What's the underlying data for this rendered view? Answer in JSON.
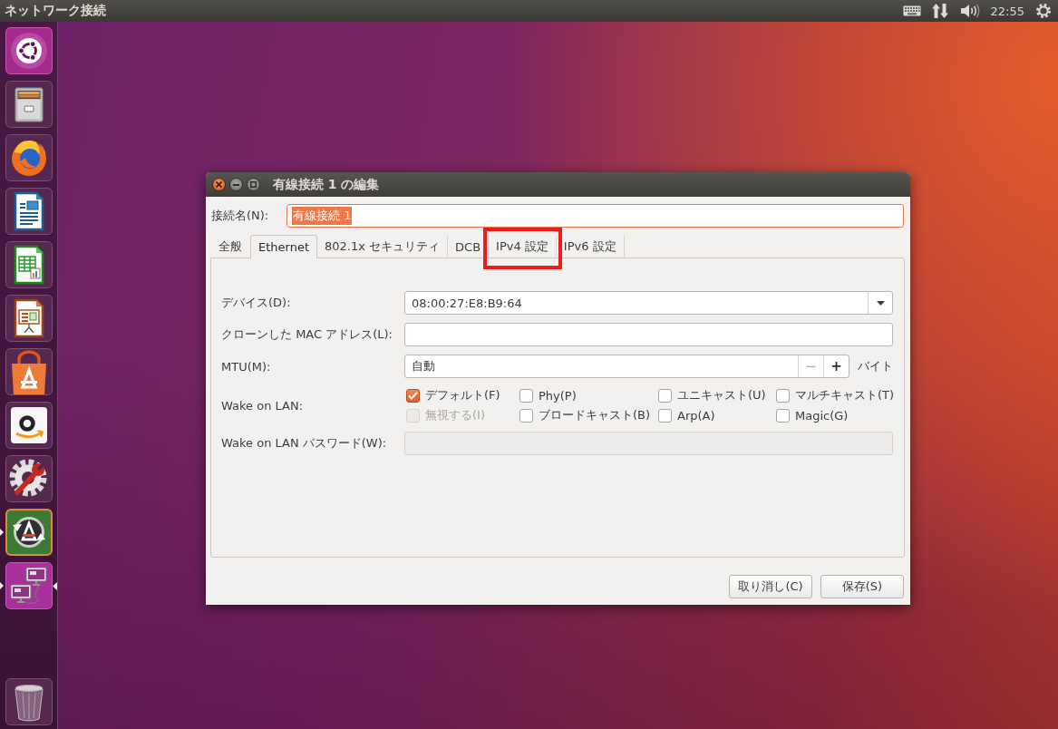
{
  "top_panel": {
    "title": "ネットワーク接続",
    "clock": "22:55"
  },
  "launcher": {
    "items": [
      {
        "kind": "dash",
        "running": false,
        "focused": false
      },
      {
        "kind": "files",
        "running": false,
        "focused": false
      },
      {
        "kind": "browser",
        "running": false,
        "focused": false
      },
      {
        "kind": "writer",
        "running": false,
        "focused": false
      },
      {
        "kind": "spreadsheet",
        "running": false,
        "focused": false
      },
      {
        "kind": "presentation",
        "running": false,
        "focused": false
      },
      {
        "kind": "software",
        "running": false,
        "focused": false
      },
      {
        "kind": "store",
        "running": false,
        "focused": false
      },
      {
        "kind": "settings",
        "running": false,
        "focused": false
      },
      {
        "kind": "updater",
        "running": true,
        "focused": false
      },
      {
        "kind": "network",
        "running": true,
        "focused": true
      },
      {
        "kind": "trash",
        "running": false,
        "focused": false
      }
    ]
  },
  "dialog": {
    "title": "有線接続 1 の編集",
    "connection_name": {
      "label": "接続名(N):",
      "value": "有線接続 1",
      "text_selected": true
    },
    "tabs": [
      {
        "label": "全般",
        "selected": false,
        "highlighted": false
      },
      {
        "label": "Ethernet",
        "selected": true,
        "highlighted": false
      },
      {
        "label": "802.1x セキュリティ",
        "selected": false,
        "highlighted": false
      },
      {
        "label": "DCB",
        "selected": false,
        "highlighted": false
      },
      {
        "label": "IPv4 設定",
        "selected": false,
        "highlighted": true
      },
      {
        "label": "IPv6 設定",
        "selected": false,
        "highlighted": false
      }
    ],
    "fields": [
      {
        "kind": "combo",
        "label": "デバイス(D):",
        "value": "08:00:27:E8:B9:64"
      },
      {
        "kind": "entry",
        "label": "クローンした MAC アドレス(L):",
        "disabled": false
      },
      {
        "kind": "spin",
        "label": "MTU(M):",
        "value": "自動",
        "steppers": [
          {
            "label": "−",
            "disabled": true
          },
          {
            "label": "+",
            "disabled": false
          }
        ],
        "unit": "バイト"
      },
      {
        "kind": "checks",
        "label": "Wake on LAN:",
        "options": [
          {
            "label": "デフォルト(F)",
            "checked": true,
            "disabled": false
          },
          {
            "label": "Phy(P)",
            "checked": false,
            "disabled": false
          },
          {
            "label": "ユニキャスト(U)",
            "checked": false,
            "disabled": false
          },
          {
            "label": "マルチキャスト(T)",
            "checked": false,
            "disabled": false
          },
          {
            "label": "無視する(I)",
            "checked": false,
            "disabled": true
          },
          {
            "label": "ブロードキャスト(B)",
            "checked": false,
            "disabled": false
          },
          {
            "label": "Arp(A)",
            "checked": false,
            "disabled": false
          },
          {
            "label": "Magic(G)",
            "checked": false,
            "disabled": false
          }
        ]
      },
      {
        "kind": "entry",
        "label": "Wake on LAN パスワード(W):",
        "disabled": true
      }
    ],
    "buttons": [
      {
        "label": "取り消し(C)"
      },
      {
        "label": "保存(S)"
      }
    ]
  }
}
